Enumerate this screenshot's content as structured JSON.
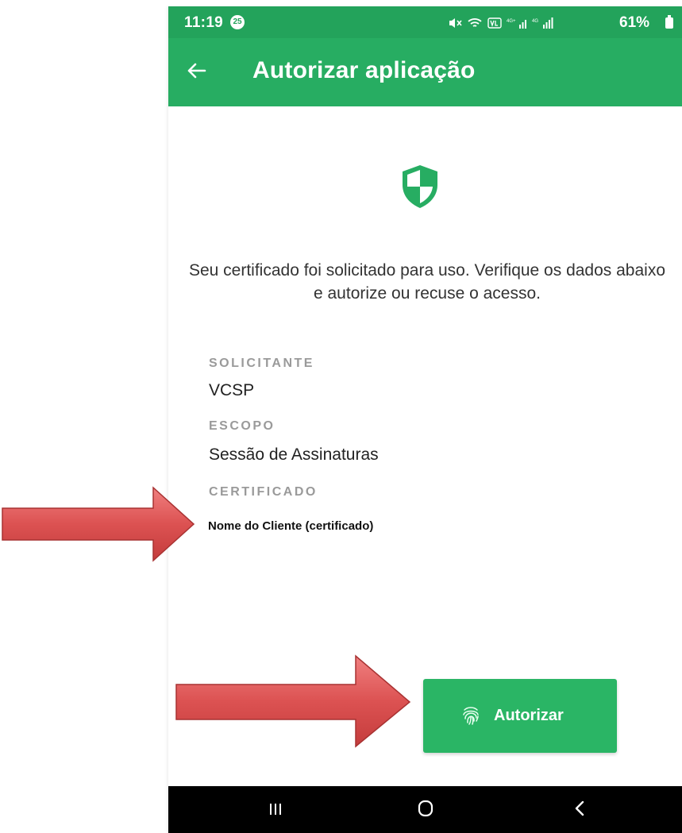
{
  "status_bar": {
    "time": "11:19",
    "notification_badge": "25",
    "battery": "61%",
    "signal_4g_label": "4G"
  },
  "app_bar": {
    "title": "Autorizar aplicação",
    "back_icon": "arrow-left-icon"
  },
  "main": {
    "header_icon": "shield-icon",
    "description": "Seu certificado foi solicitado para uso. Verifique os dados abaixo e autorize ou recuse o acesso.",
    "fields": [
      {
        "label": "SOLICITANTE",
        "value": "VCSP"
      },
      {
        "label": "ESCOPO",
        "value": "Sessão de Assinaturas"
      },
      {
        "label": "CERTIFICADO",
        "value": "Nome do Cliente (certificado)"
      }
    ]
  },
  "actions": {
    "authorize_label": "Autorizar",
    "authorize_icon": "fingerprint-icon"
  },
  "nav_bar": {
    "items": [
      "recent-apps-icon",
      "home-icon",
      "back-icon"
    ]
  },
  "colors": {
    "primary_green": "#27ad62",
    "status_green": "#23a35b",
    "button_green": "#2ab565",
    "arrow_red": "#d94f4f",
    "label_gray": "#9a9a9a"
  }
}
